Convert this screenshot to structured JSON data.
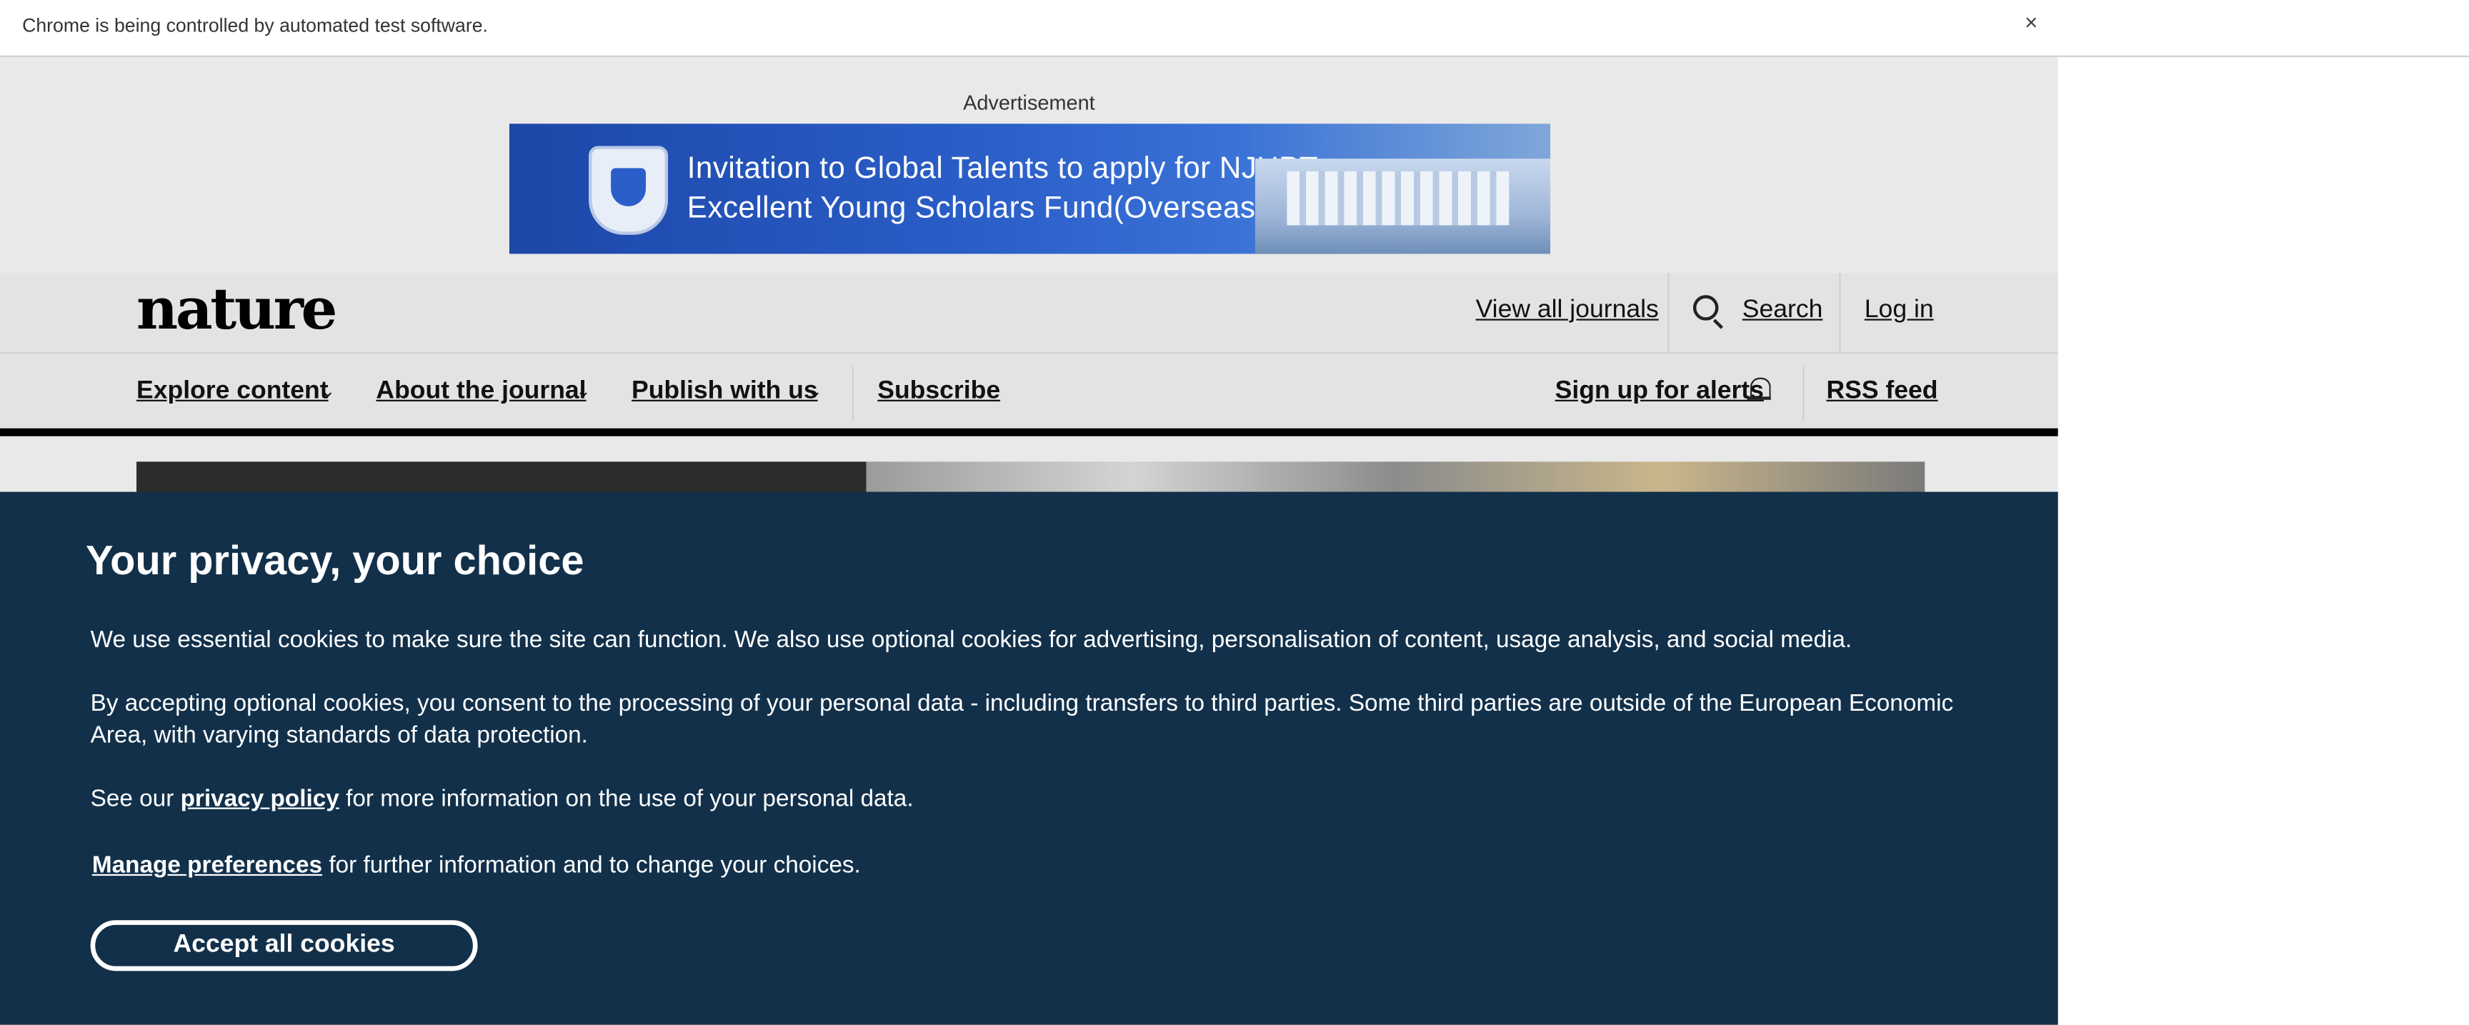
{
  "browser": {
    "infobar_text": "Chrome is being controlled by automated test software.",
    "close_label": "×"
  },
  "ad": {
    "label": "Advertisement",
    "banner_line1": "Invitation to Global Talents to apply for NJUPT",
    "banner_line2": "Excellent Young Scholars Fund(Overseas)"
  },
  "header": {
    "logo": "nature",
    "view_all_journals": "View all journals",
    "search": "Search",
    "login": "Log in"
  },
  "nav": {
    "items": [
      {
        "label": "Explore content",
        "dropdown": true
      },
      {
        "label": "About the journal",
        "dropdown": true
      },
      {
        "label": "Publish with us",
        "dropdown": true
      },
      {
        "label": "Subscribe",
        "dropdown": false
      }
    ],
    "chevron": "⌄",
    "alerts": "Sign up for alerts",
    "rss": "RSS feed"
  },
  "cookie": {
    "title": "Your privacy, your choice",
    "p1": "We use essential cookies to make sure the site can function. We also use optional cookies for advertising, personalisation of content, usage analysis, and social media.",
    "p2": "By accepting optional cookies, you consent to the processing of your personal data - including transfers to third parties. Some third parties are outside of the European Economic Area, with varying standards of data protection.",
    "p3_before": "See our",
    "p3_link": "privacy policy",
    "p3_after": "for more information on the use of your personal data.",
    "p4_link": "Manage preferences",
    "p4_after": "for further information and to change your choices.",
    "accept": "Accept all cookies"
  },
  "colors": {
    "cookie_bg": "#12304a",
    "header_bg": "#e3e3e3",
    "ad_blue": "#2a5ec8"
  }
}
